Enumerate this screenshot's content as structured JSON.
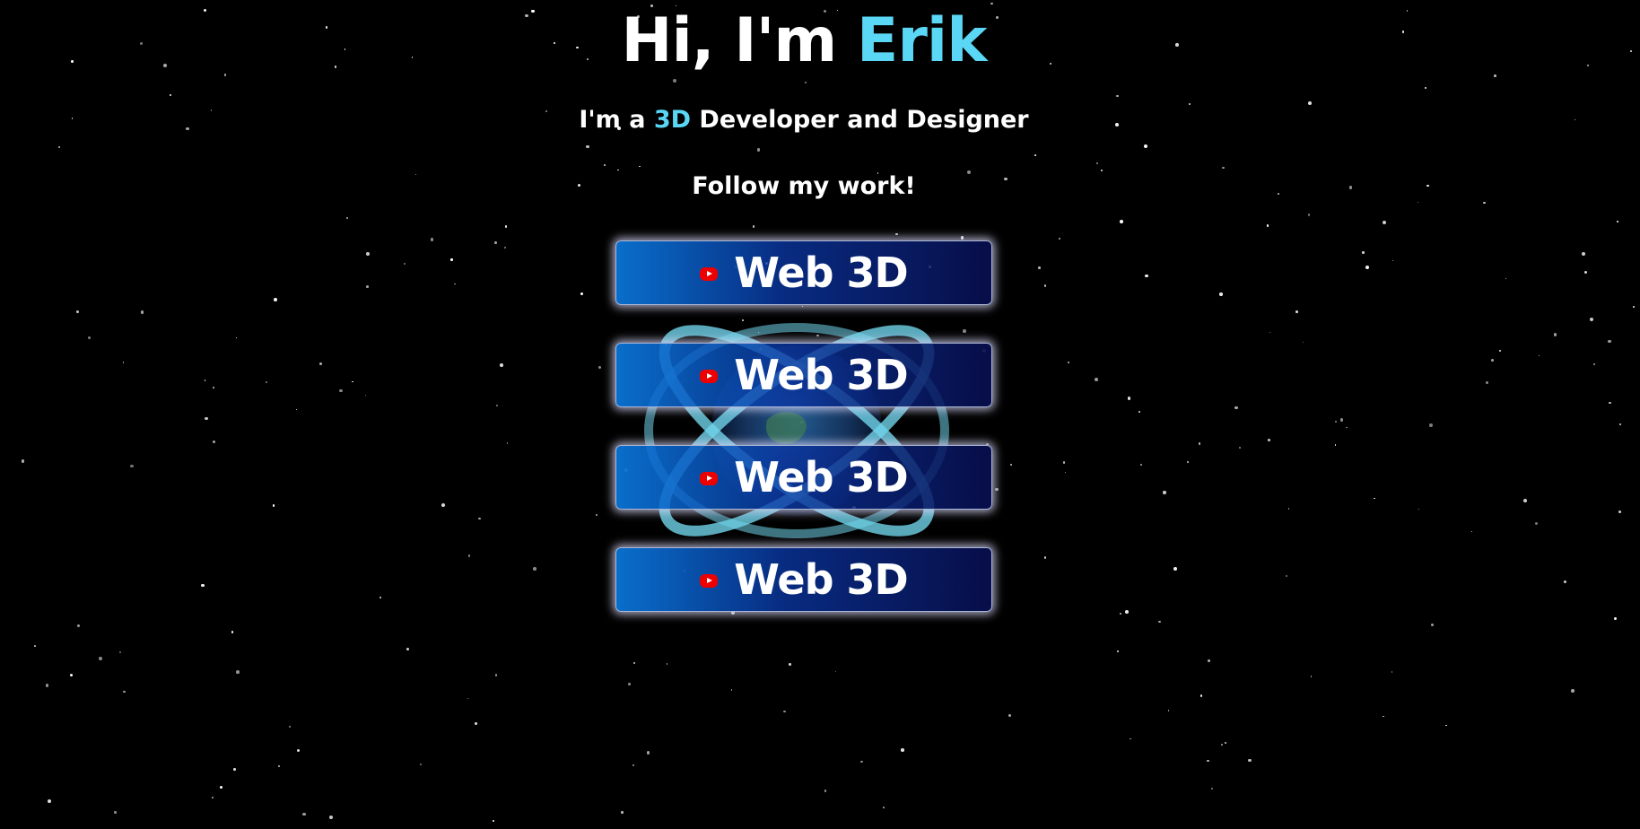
{
  "hero": {
    "greeting": "Hi, I'm ",
    "name": "Erik"
  },
  "subtitle": {
    "prefix": "I'm a ",
    "highlight": "3D",
    "suffix": " Developer and Designer"
  },
  "follow_text": "Follow my work!",
  "links": [
    {
      "label": "Web 3D",
      "icon": "youtube-icon"
    },
    {
      "label": "Web 3D",
      "icon": "youtube-icon"
    },
    {
      "label": "Web 3D",
      "icon": "youtube-icon"
    },
    {
      "label": "Web 3D",
      "icon": "youtube-icon"
    }
  ],
  "colors": {
    "background": "#000000",
    "accent": "#5ad7f5",
    "text": "#ffffff",
    "youtube_red": "#ee0000",
    "ring": "#6fd3ea"
  }
}
